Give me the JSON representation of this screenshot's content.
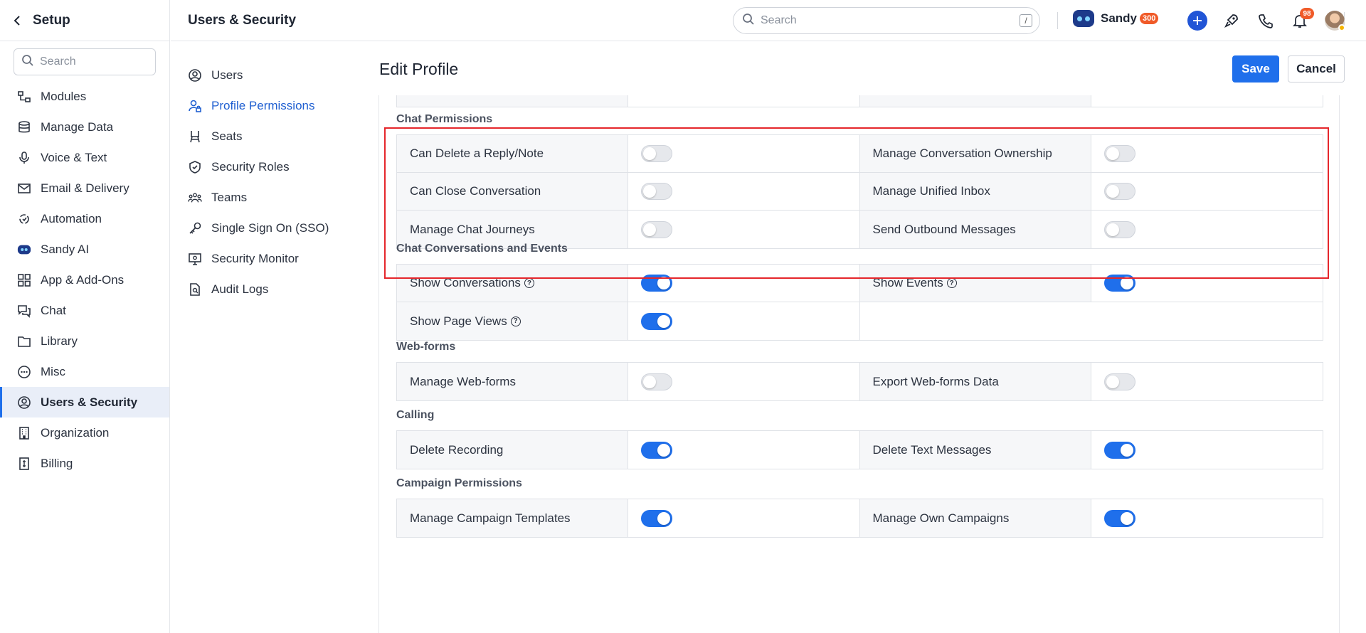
{
  "sidebar": {
    "title": "Setup",
    "search_placeholder": "Search",
    "items": [
      {
        "label": "Modules",
        "icon": "modules-icon"
      },
      {
        "label": "Manage Data",
        "icon": "database-icon"
      },
      {
        "label": "Voice & Text",
        "icon": "microphone-icon"
      },
      {
        "label": "Email & Delivery",
        "icon": "mail-icon"
      },
      {
        "label": "Automation",
        "icon": "automation-icon"
      },
      {
        "label": "Sandy AI",
        "icon": "sandy-bot-icon"
      },
      {
        "label": "App & Add-Ons",
        "icon": "apps-grid-icon"
      },
      {
        "label": "Chat",
        "icon": "chat-icon"
      },
      {
        "label": "Library",
        "icon": "folder-icon"
      },
      {
        "label": "Misc",
        "icon": "more-circle-icon"
      },
      {
        "label": "Users & Security",
        "icon": "user-circle-icon",
        "active": true
      },
      {
        "label": "Organization",
        "icon": "building-icon"
      },
      {
        "label": "Billing",
        "icon": "invoice-icon"
      }
    ]
  },
  "topbar": {
    "title": "Users & Security",
    "search_placeholder": "Search",
    "search_shortcut": "/",
    "assistant_name": "Sandy",
    "assistant_credits": "300",
    "notification_count": "98"
  },
  "subnav": {
    "items": [
      {
        "label": "Users",
        "icon": "user-circle-icon"
      },
      {
        "label": "Profile Permissions",
        "icon": "user-lock-icon",
        "active": true
      },
      {
        "label": "Seats",
        "icon": "chair-icon"
      },
      {
        "label": "Security Roles",
        "icon": "shield-icon"
      },
      {
        "label": "Teams",
        "icon": "team-icon"
      },
      {
        "label": "Single Sign On (SSO)",
        "icon": "key-icon"
      },
      {
        "label": "Security Monitor",
        "icon": "monitor-icon"
      },
      {
        "label": "Audit Logs",
        "icon": "file-search-icon"
      }
    ]
  },
  "main": {
    "title": "Edit Profile",
    "save_label": "Save",
    "cancel_label": "Cancel"
  },
  "sections": [
    {
      "title": "Chat Permissions",
      "rows": [
        [
          {
            "label": "Can Delete a Reply/Note",
            "on": false
          },
          {
            "label": "Manage Conversation Ownership",
            "on": false
          }
        ],
        [
          {
            "label": "Can Close Conversation",
            "on": false
          },
          {
            "label": "Manage Unified Inbox",
            "on": false
          }
        ],
        [
          {
            "label": "Manage Chat Journeys",
            "on": false
          },
          {
            "label": "Send Outbound Messages",
            "on": false
          }
        ]
      ]
    },
    {
      "title": "Chat Conversations and Events",
      "rows": [
        [
          {
            "label": "Show Conversations",
            "on": true,
            "help": true
          },
          {
            "label": "Show Events",
            "on": true,
            "help": true
          }
        ],
        [
          {
            "label": "Show Page Views",
            "on": true,
            "help": true
          }
        ]
      ]
    },
    {
      "title": "Web-forms",
      "rows": [
        [
          {
            "label": "Manage Web-forms",
            "on": false
          },
          {
            "label": "Export Web-forms Data",
            "on": false
          }
        ]
      ]
    },
    {
      "title": "Calling",
      "rows": [
        [
          {
            "label": "Delete Recording",
            "on": true
          },
          {
            "label": "Delete Text Messages",
            "on": true
          }
        ]
      ]
    },
    {
      "title": "Campaign Permissions",
      "rows": [
        [
          {
            "label": "Manage Campaign Templates",
            "on": true
          },
          {
            "label": "Manage Own Campaigns",
            "on": true
          }
        ]
      ]
    }
  ],
  "colors": {
    "accent": "#1f6feb",
    "highlight_box": "#e5262b",
    "badge": "#f05a28"
  }
}
